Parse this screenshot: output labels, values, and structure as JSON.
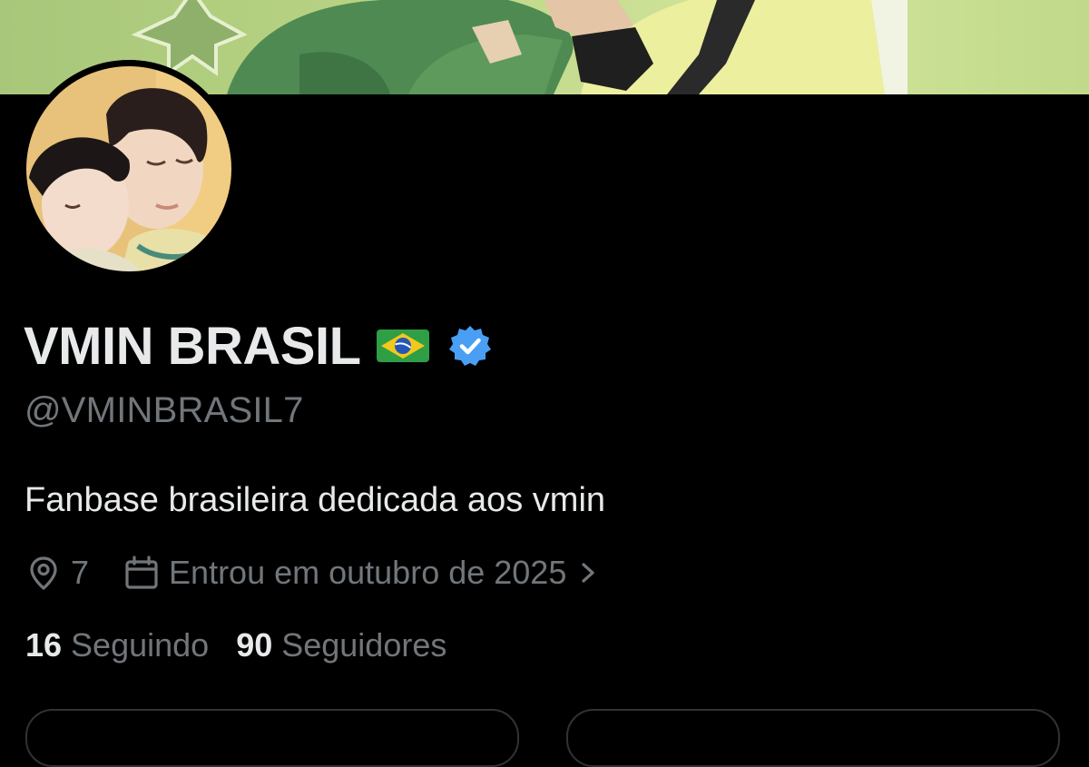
{
  "profile": {
    "display_name": "VMIN BRASIL",
    "flag_icon": "brazil-flag-emoji",
    "verified_icon": "verified-badge-icon",
    "verified_color": "#4a9ff5",
    "handle": "@VMINBRASIL7",
    "bio": "Fanbase brasileira dedicada aos vmin",
    "location_icon": "location-pin-icon",
    "location": "7",
    "joined_icon": "calendar-icon",
    "joined": "Entrou em outubro de 2025",
    "joined_chevron_icon": "chevron-right-icon",
    "following_count": "16",
    "following_label": "Seguindo",
    "followers_count": "90",
    "followers_label": "Seguidores"
  },
  "colors": {
    "background": "#000000",
    "primary_text": "#e7e9ea",
    "secondary_text": "#71767b",
    "banner_green": "#bfd88c"
  }
}
